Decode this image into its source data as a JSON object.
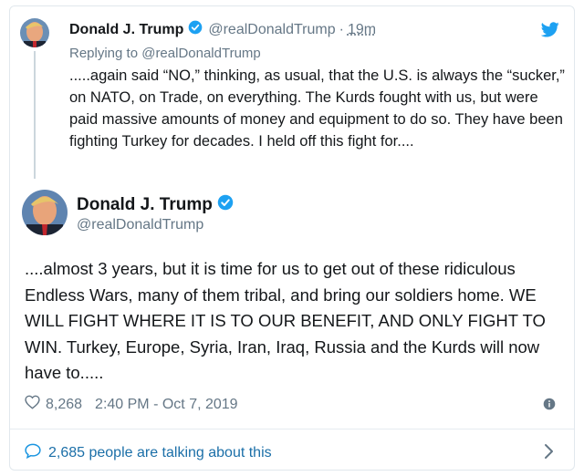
{
  "reply_tweet": {
    "author_name": "Donald J. Trump",
    "author_handle": "@realDonaldTrump",
    "separator": "·",
    "time": "19m",
    "replying_to": "Replying to @realDonaldTrump",
    "text": ".....again said “NO,” thinking, as usual, that the U.S. is always the “sucker,” on NATO, on Trade, on everything. The Kurds fought with us, but were paid massive amounts of money and equipment to do so. They have been fighting Turkey for decades. I held off this fight for...."
  },
  "main_tweet": {
    "author_name": "Donald J. Trump",
    "author_handle": "@realDonaldTrump",
    "text": "....almost 3 years, but it is time for us to get out of these ridiculous Endless Wars, many of them tribal, and bring our soldiers home. WE WILL FIGHT WHERE IT IS TO OUR BENEFIT, AND ONLY FIGHT TO WIN. Turkey, Europe, Syria, Iran, Iraq, Russia and the Kurds will now have to.....",
    "likes": "8,268",
    "timestamp": "2:40 PM - Oct 7, 2019"
  },
  "footer": {
    "talking_label": "2,685 people are talking about this"
  },
  "icons": {
    "verified": "verified-badge-icon",
    "twitter": "twitter-bird-icon",
    "heart": "heart-icon",
    "info": "info-icon",
    "comment": "comment-bubble-icon",
    "chevron": "chevron-right-icon"
  },
  "colors": {
    "accent": "#1da1f2",
    "link": "#1b6fa8",
    "muted": "#657786",
    "text": "#14171a"
  }
}
